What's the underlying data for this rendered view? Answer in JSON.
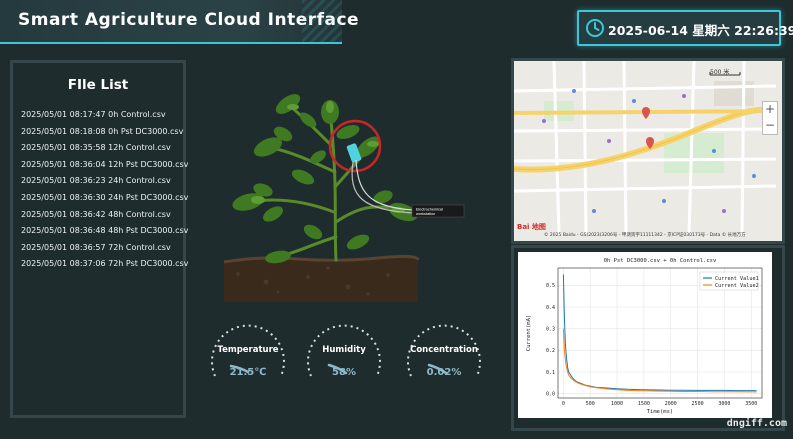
{
  "header": {
    "title": "Smart Agriculture Cloud Interface",
    "datetime": "2025-06-14 星期六 22:26:39",
    "clock_icon": "clock-icon",
    "accent_color": "#3cc7d6"
  },
  "files": {
    "heading": "FIle List",
    "items": [
      "2025/05/01 08:17:47 0h Control.csv",
      "2025/05/01 08:18:08 0h Pst DC3000.csv",
      "2025/05/01 08:35:58 12h Control.csv",
      "2025/05/01 08:36:04 12h Pst DC3000.csv",
      "2025/05/01 08:36:23 24h Control.csv",
      "2025/05/01 08:36:30 24h Pst DC3000.csv",
      "2025/05/01 08:36:42 48h Control.csv",
      "2025/05/01 08:36:48 48h Pst DC3000.csv",
      "2025/05/01 08:36:57 72h Control.csv",
      "2025/05/01 08:37:06 72h Pst DC3000.csv"
    ]
  },
  "plant": {
    "device_label": "Electrochemical workstation"
  },
  "gauges": [
    {
      "label": "Temperature",
      "value": "21.5℃"
    },
    {
      "label": "Humidity",
      "value": "58%"
    },
    {
      "label": "Concentration",
      "value": "0.02%"
    }
  ],
  "map": {
    "scale_label": "500 米",
    "logo": "Bai 地图",
    "copyright": "© 2025 Baidu - GS(2023)3206号 - 甲测资字11111342 - 京ICP证030173号 - Data © 长地万方",
    "zoom_in": "+",
    "zoom_out": "−"
  },
  "chart_data": {
    "type": "line",
    "title": "0h Pst DC3000.csv + 0h Control.csv",
    "xlabel": "Time(ms)",
    "ylabel": "Current(mA)",
    "xlim": [
      -100,
      3700
    ],
    "ylim": [
      -0.02,
      0.58
    ],
    "xticks": [
      0,
      500,
      1000,
      1500,
      2000,
      2500,
      3000,
      3500
    ],
    "yticks": [
      0.0,
      0.1,
      0.2,
      0.3,
      0.4,
      0.5
    ],
    "grid": true,
    "legend_position": "top-right",
    "series": [
      {
        "name": "Current Value1",
        "color": "#1f77b4",
        "x": [
          0,
          20,
          40,
          60,
          80,
          100,
          150,
          200,
          250,
          300,
          400,
          500,
          600,
          700,
          800,
          1000,
          1200,
          1500,
          1800,
          2000,
          2200,
          2500,
          2800,
          3000,
          3200,
          3500,
          3600
        ],
        "y": [
          0.55,
          0.35,
          0.22,
          0.16,
          0.12,
          0.1,
          0.08,
          0.065,
          0.055,
          0.05,
          0.04,
          0.035,
          0.03,
          0.028,
          0.026,
          0.023,
          0.02,
          0.018,
          0.017,
          0.016,
          0.016,
          0.015,
          0.015,
          0.015,
          0.014,
          0.014,
          0.014
        ]
      },
      {
        "name": "Current Value2",
        "color": "#ff7f0e",
        "x": [
          0,
          20,
          40,
          60,
          80,
          100,
          150,
          200,
          250,
          300,
          400,
          500,
          600,
          700,
          800,
          1000,
          1200,
          1500,
          1800,
          2000,
          2200,
          2500,
          2800,
          3000,
          3200,
          3500,
          3600
        ],
        "y": [
          0.3,
          0.2,
          0.15,
          0.12,
          0.1,
          0.085,
          0.07,
          0.06,
          0.052,
          0.046,
          0.038,
          0.032,
          0.028,
          0.025,
          0.022,
          0.018,
          0.015,
          0.013,
          0.012,
          0.011,
          0.01,
          0.01,
          0.009,
          0.009,
          0.009,
          0.008,
          0.008
        ]
      }
    ]
  },
  "watermark": "dngiff.com"
}
